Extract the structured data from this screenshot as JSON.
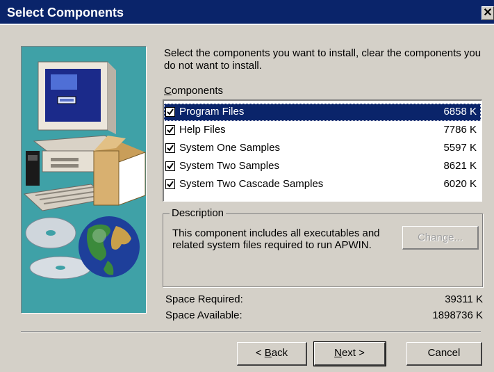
{
  "window": {
    "title": "Select Components",
    "close_glyph": "✕"
  },
  "intro_text": "Select the components you want to install, clear the components you do not want to install.",
  "components_label": {
    "first": "C",
    "rest": "omponents"
  },
  "components": [
    {
      "name": "Program Files",
      "size": "6858 K",
      "checked": true,
      "selected": true
    },
    {
      "name": "Help Files",
      "size": "7786 K",
      "checked": true,
      "selected": false
    },
    {
      "name": "System One Samples",
      "size": "5597 K",
      "checked": true,
      "selected": false
    },
    {
      "name": "System Two Samples",
      "size": "8621 K",
      "checked": true,
      "selected": false
    },
    {
      "name": "System Two Cascade Samples",
      "size": "6020 K",
      "checked": true,
      "selected": false
    }
  ],
  "description": {
    "legend": "Description",
    "text": "This component includes all executables and related system files required to run APWIN.",
    "change_label": "Change..."
  },
  "space": {
    "required_label": "Space Required:",
    "required_value": "39311 K",
    "available_label": "Space Available:",
    "available_value": "1898736 K"
  },
  "buttons": {
    "back_prefix": "< ",
    "back_key": "B",
    "back_rest": "ack",
    "next_key": "N",
    "next_rest": "ext >",
    "cancel": "Cancel"
  },
  "colors": {
    "titlebar": "#0a246a",
    "dialog_face": "#d4d0c8",
    "illustration_bg": "#3fa1a7",
    "selection": "#0a246a"
  }
}
